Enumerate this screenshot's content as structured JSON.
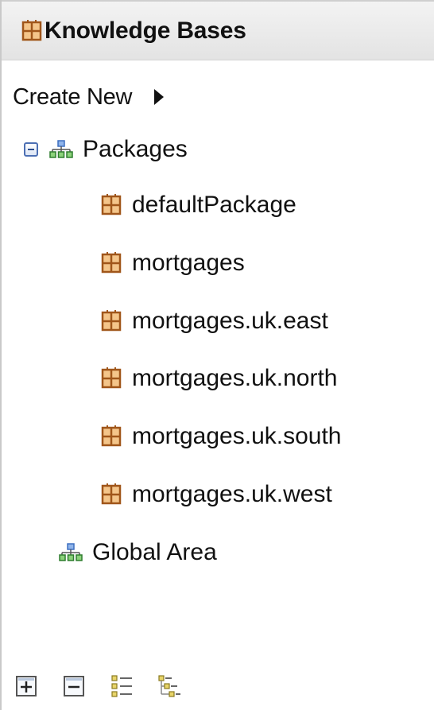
{
  "header": {
    "title": "Knowledge Bases"
  },
  "create_new": {
    "label": "Create New"
  },
  "tree": {
    "root": {
      "label": "Packages",
      "expanded": true,
      "children": [
        "defaultPackage",
        "mortgages",
        "mortgages.uk.east",
        "mortgages.uk.north",
        "mortgages.uk.south",
        "mortgages.uk.west"
      ]
    },
    "global_area": {
      "label": "Global Area"
    }
  },
  "toolbar": {
    "buttons": [
      "expand-all-icon",
      "collapse-all-icon",
      "show-as-list-icon",
      "show-as-tree-icon"
    ]
  },
  "colors": {
    "package_icon": "#b5651d",
    "hierarchy_top": "#5b8ed6",
    "hierarchy_bottom": "#3e9b3e",
    "toggle_border": "#4c6fb3"
  }
}
